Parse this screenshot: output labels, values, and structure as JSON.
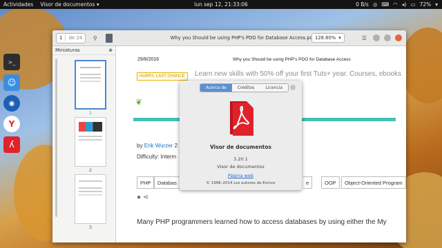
{
  "topbar": {
    "activities": "Actividades",
    "app_menu": "Visor de documentos",
    "clock": "lun sep 12, 21:33:06",
    "speed": "0 B/s",
    "battery": "72%"
  },
  "header": {
    "page_current": "1",
    "page_total": "de 24",
    "title": "Why you Should be using PHP's PDO for Database Access.pdf",
    "zoom": "128.80%"
  },
  "sidebar": {
    "title": "Miniaturas",
    "thumbnails": [
      "1",
      "2",
      "3"
    ]
  },
  "document": {
    "date": "29/8/2016",
    "running_head": "Why you Should be using PHP's PDO for Database Access",
    "hurry_badge": "HURRY, LAST CHANCE",
    "promo": "Learn new skills with 50% off your first Tuts+ year. Courses, ebooks",
    "by_prefix": "by",
    "author": "Erik Wurzer",
    "author_suffix": "2",
    "difficulty": "Difficulty: Interm",
    "tags": [
      "PHP",
      "Databas",
      "e",
      "OOP",
      "Object-Oriented Program"
    ],
    "body": "Many PHP programmers learned how to access databases by using either the My"
  },
  "about": {
    "tabs": [
      "Acerca de",
      "Créditos",
      "Licencia"
    ],
    "app_name": "Visor de documentos",
    "version": "3.20.1",
    "description": "Visor de documentos",
    "website": "Página web",
    "copyright": "© 1996–2014 Los autores de Evince"
  },
  "colors": {
    "accent": "#5b8fd1",
    "teal": "#45c1b6",
    "pdf_red": "#e0222b"
  }
}
